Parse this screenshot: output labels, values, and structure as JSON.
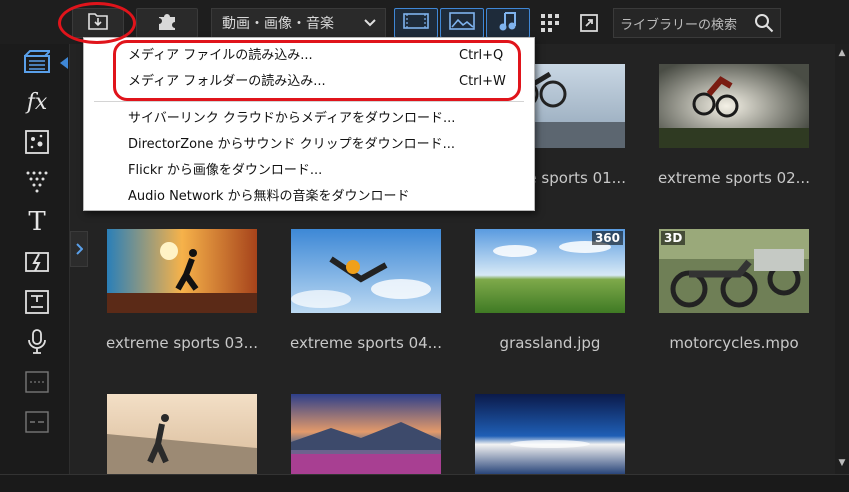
{
  "toolbar": {
    "import_icon": "import-media-icon",
    "plugin_icon": "puzzle-icon",
    "filter_value": "動画・画像・音楽",
    "view_buttons": [
      "video-view-icon",
      "image-view-icon",
      "music-view-icon"
    ],
    "sort_icon": "grid-sort-icon",
    "resize_icon": "resize-icon",
    "search_placeholder": "ライブラリーの検索"
  },
  "import_menu": {
    "items": [
      {
        "label": "メディア ファイルの読み込み...",
        "shortcut": "Ctrl+Q"
      },
      {
        "label": "メディア フォルダーの読み込み...",
        "shortcut": "Ctrl+W"
      },
      {
        "label": "サイバーリンク クラウドからメディアをダウンロード...",
        "shortcut": ""
      },
      {
        "label": "DirectorZone からサウンド クリップをダウンロード...",
        "shortcut": ""
      },
      {
        "label": "Flickr から画像をダウンロード...",
        "shortcut": ""
      },
      {
        "label": "Audio Network から無料の音楽をダウンロード",
        "shortcut": ""
      }
    ]
  },
  "sidebar": {
    "items": [
      "media-room-icon",
      "fx-icon",
      "particle-icon",
      "title-icon",
      "text-icon",
      "transition-icon",
      "subtitle-icon",
      "voiceover-icon",
      "chapter-icon",
      "caption-icon"
    ],
    "fx_glyph": "fx",
    "text_glyph": "T"
  },
  "media": {
    "items": [
      {
        "caption": "extreme sports 01...",
        "badge": ""
      },
      {
        "caption": "extreme sports 02...",
        "badge": ""
      },
      {
        "caption": "extreme sports 03...",
        "badge": ""
      },
      {
        "caption": "extreme sports 04...",
        "badge": ""
      },
      {
        "caption": "grassland.jpg",
        "badge": "360"
      },
      {
        "caption": "motorcycles.mpo",
        "badge": "3D"
      },
      {
        "caption": "",
        "badge": ""
      },
      {
        "caption": "",
        "badge": ""
      },
      {
        "caption": "",
        "badge": ""
      }
    ]
  },
  "colors": {
    "accent": "#3f87d6",
    "highlight_red": "#e0141b"
  }
}
